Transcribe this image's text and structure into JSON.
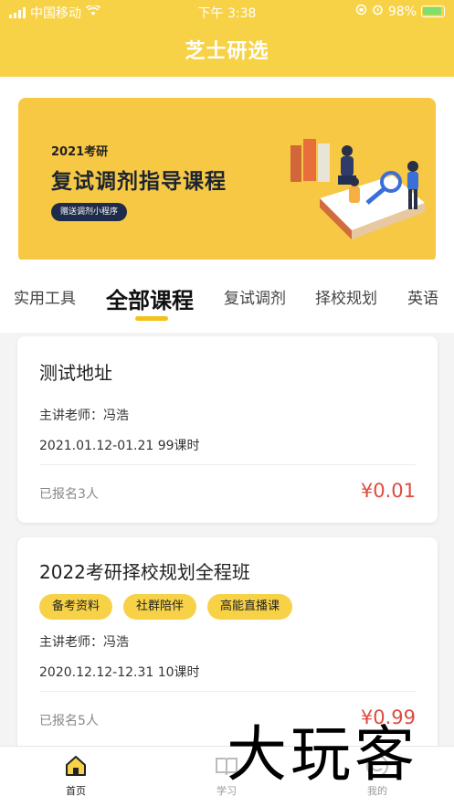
{
  "status_bar": {
    "carrier": "中国移动",
    "time": "下午 3:38",
    "battery": "98%"
  },
  "header": {
    "title": "芝士研选"
  },
  "banner": {
    "year_label": "2021考研",
    "headline": "复试调剂指导课程",
    "pill": "赠送调剂小程序"
  },
  "tabs": [
    {
      "label": "实用工具"
    },
    {
      "label": "全部课程",
      "active": true
    },
    {
      "label": "复试调剂"
    },
    {
      "label": "择校规划"
    },
    {
      "label": "英语"
    }
  ],
  "courses": [
    {
      "name": "测试地址",
      "tags": [],
      "teacher": "主讲老师：冯浩",
      "dates": "2021.01.12-01.21 99课时",
      "enrolled": "已报名3人",
      "price": "¥0.01"
    },
    {
      "name": "2022考研择校规划全程班",
      "tags": [
        "备考资料",
        "社群陪伴",
        "高能直播课"
      ],
      "teacher": "主讲老师：冯浩",
      "dates": "2020.12.12-12.31 10课时",
      "enrolled": "已报名5人",
      "price": "¥0.99"
    }
  ],
  "tabbar": [
    {
      "label": "首页",
      "icon": "home-icon",
      "active": true
    },
    {
      "label": "学习",
      "icon": "book-icon"
    },
    {
      "label": "我的",
      "icon": "user-icon"
    }
  ],
  "watermark": "大玩客",
  "colors": {
    "accent": "#f7d247",
    "price": "#e04a3f",
    "banner_dark": "#1f2b4a"
  }
}
